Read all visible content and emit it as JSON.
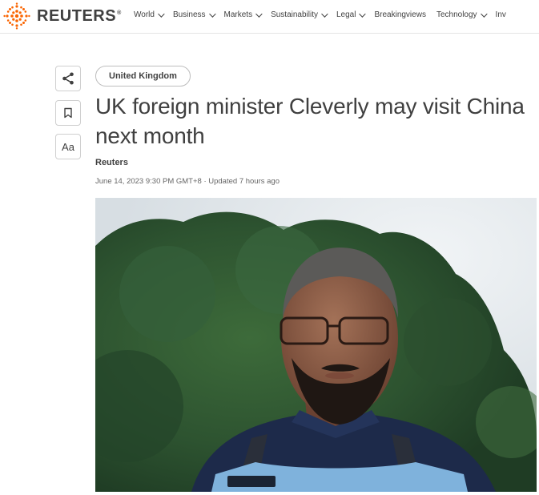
{
  "brand": {
    "name": "REUTERS",
    "reg": "®"
  },
  "nav": {
    "items": [
      {
        "label": "World",
        "dropdown": true
      },
      {
        "label": "Business",
        "dropdown": true
      },
      {
        "label": "Markets",
        "dropdown": true
      },
      {
        "label": "Sustainability",
        "dropdown": true
      },
      {
        "label": "Legal",
        "dropdown": true
      },
      {
        "label": "Breakingviews",
        "dropdown": false
      },
      {
        "label": "Technology",
        "dropdown": true
      },
      {
        "label": "Inv",
        "dropdown": false
      }
    ]
  },
  "tools": {
    "text_size_label": "Aa"
  },
  "article": {
    "tag": "United Kingdom",
    "headline": "UK foreign minister Cleverly may visit China next month",
    "byline": "Reuters",
    "dateline": "June 14, 2023 9:30 PM GMT+8 · Updated 7 hours ago"
  },
  "colors": {
    "brand_orange": "#fa6400",
    "text": "#404040"
  },
  "icons": [
    "reuters-logo-icon",
    "share-icon",
    "bookmark-icon",
    "chevron-down-icon"
  ]
}
